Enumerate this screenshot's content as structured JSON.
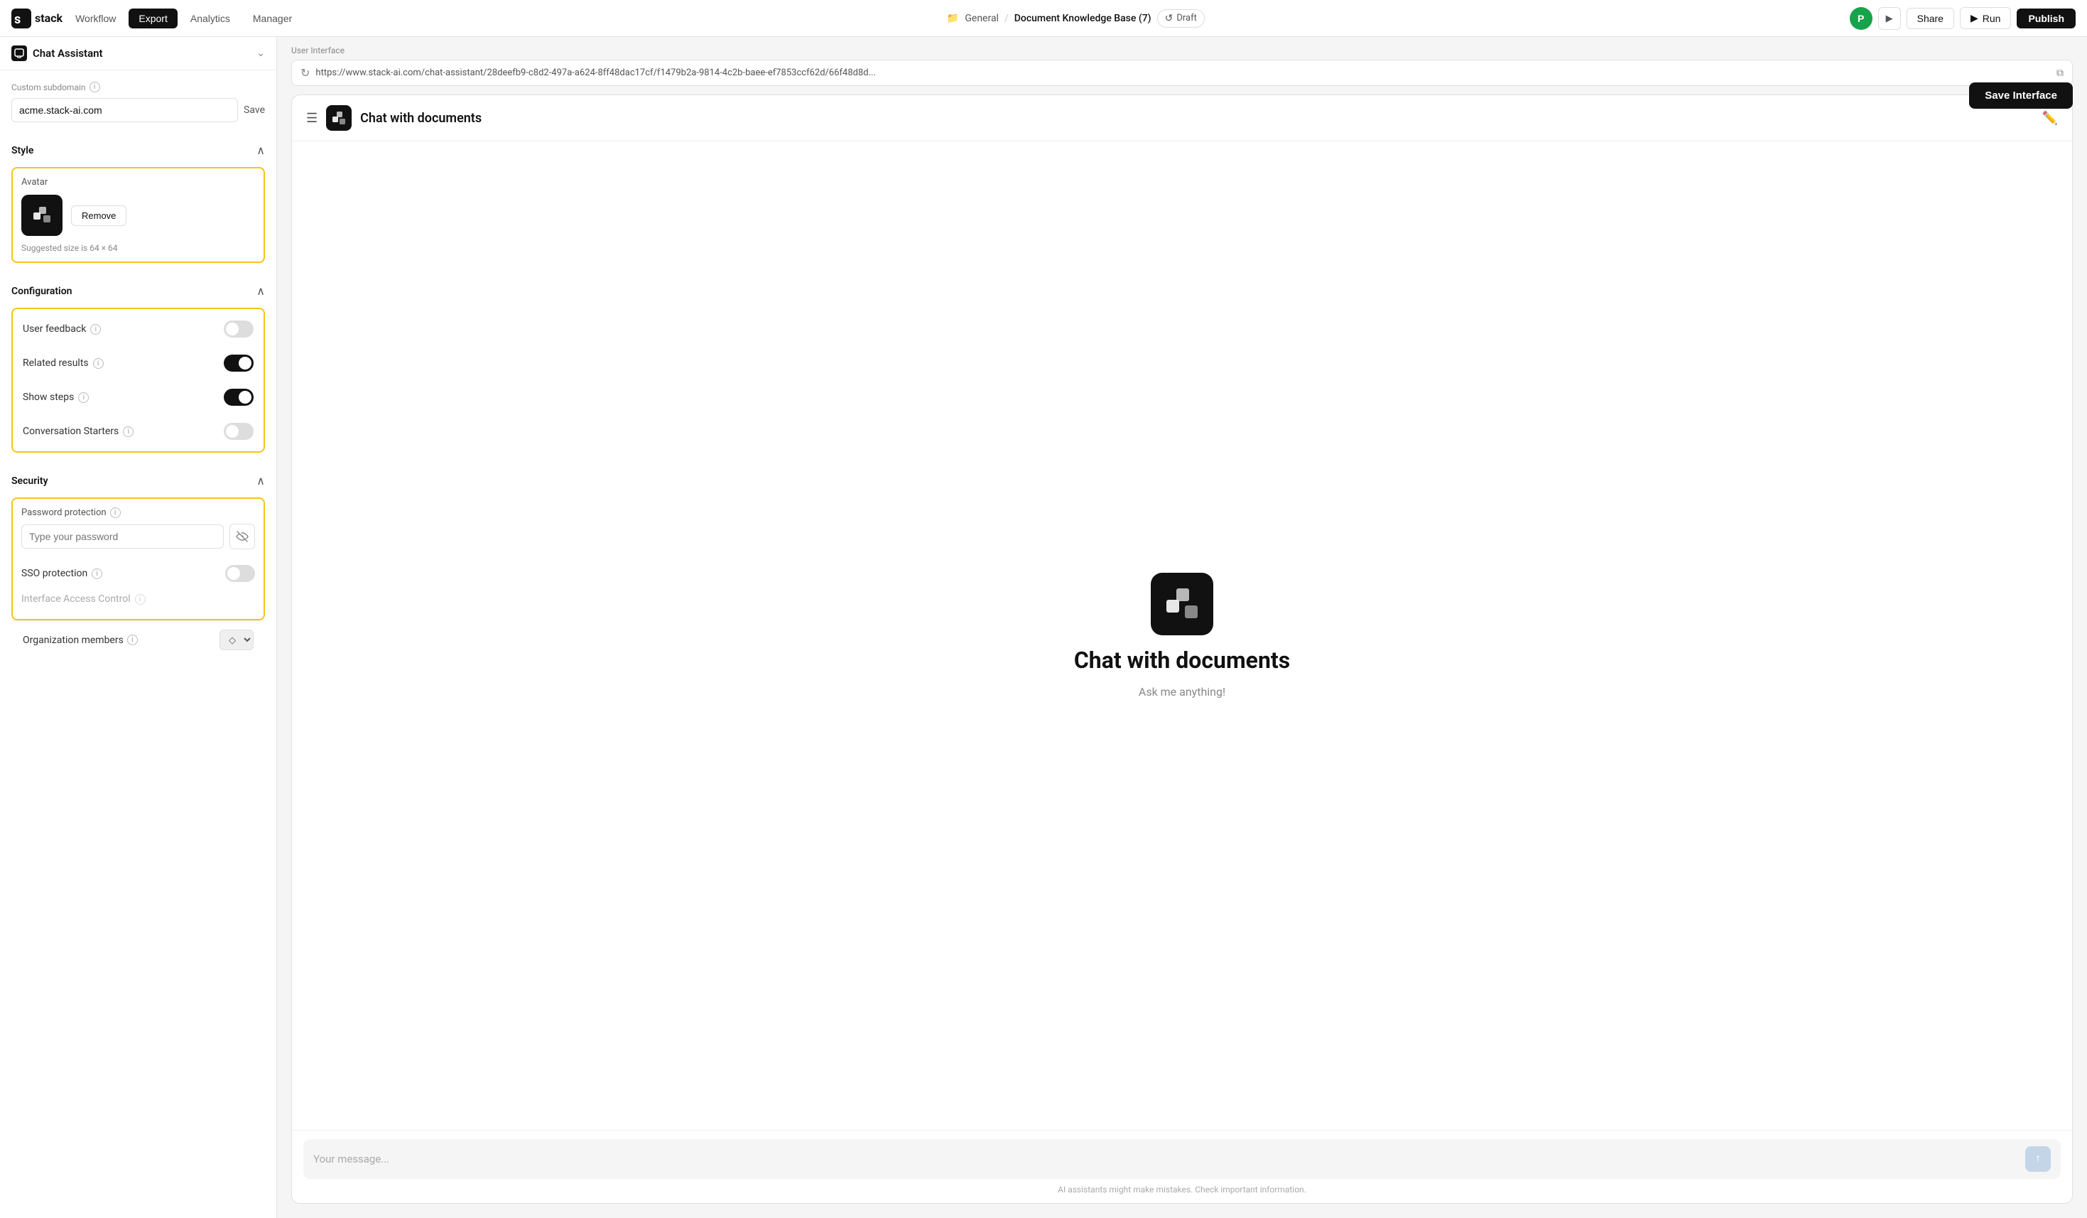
{
  "app": {
    "logo_text": "stack",
    "nav_items": [
      "Workflow",
      "Export",
      "Analytics",
      "Manager"
    ],
    "active_nav": "Export"
  },
  "header": {
    "folder": "General",
    "separator": "/",
    "project": "Document Knowledge Base (7)",
    "draft_label": "Draft",
    "avatar_initial": "P",
    "share_label": "Share",
    "run_label": "Run",
    "publish_label": "Publish",
    "save_interface_label": "Save Interface"
  },
  "sidebar": {
    "title": "Chat Assistant",
    "subdomain_label": "Custom subdomain",
    "subdomain_value": "acme.stack-ai.com",
    "subdomain_placeholder": "acme.stack-ai.com",
    "save_label": "Save",
    "style_section": {
      "title": "Style",
      "avatar_label": "Avatar",
      "avatar_hint": "Suggested size is 64 × 64",
      "remove_btn": "Remove"
    },
    "configuration_section": {
      "title": "Configuration",
      "user_feedback_label": "User feedback",
      "related_results_label": "Related results",
      "show_steps_label": "Show steps",
      "conversation_starters_label": "Conversation Starters",
      "user_feedback_on": false,
      "related_results_on": true,
      "show_steps_on": true,
      "conversation_starters_on": false
    },
    "security_section": {
      "title": "Security",
      "password_protection_label": "Password protection",
      "password_placeholder": "Type your password",
      "sso_protection_label": "SSO protection",
      "sso_on": false,
      "interface_access_label": "Interface Access Control",
      "org_members_label": "Organization members",
      "org_select_value": "◇"
    }
  },
  "chat_preview": {
    "url": "https://www.stack-ai.com/chat-assistant/28deefb9-c8d2-497a-a624-8ff48dac17cf/f1479b2a-9814-4c2b-baee-ef7853ccf62d/66f48d8d...",
    "ui_label": "User Interface",
    "title": "Chat with documents",
    "subtitle": "Ask me anything!",
    "message_placeholder": "Your message...",
    "disclaimer": "AI assistants might make mistakes. Check important information."
  }
}
